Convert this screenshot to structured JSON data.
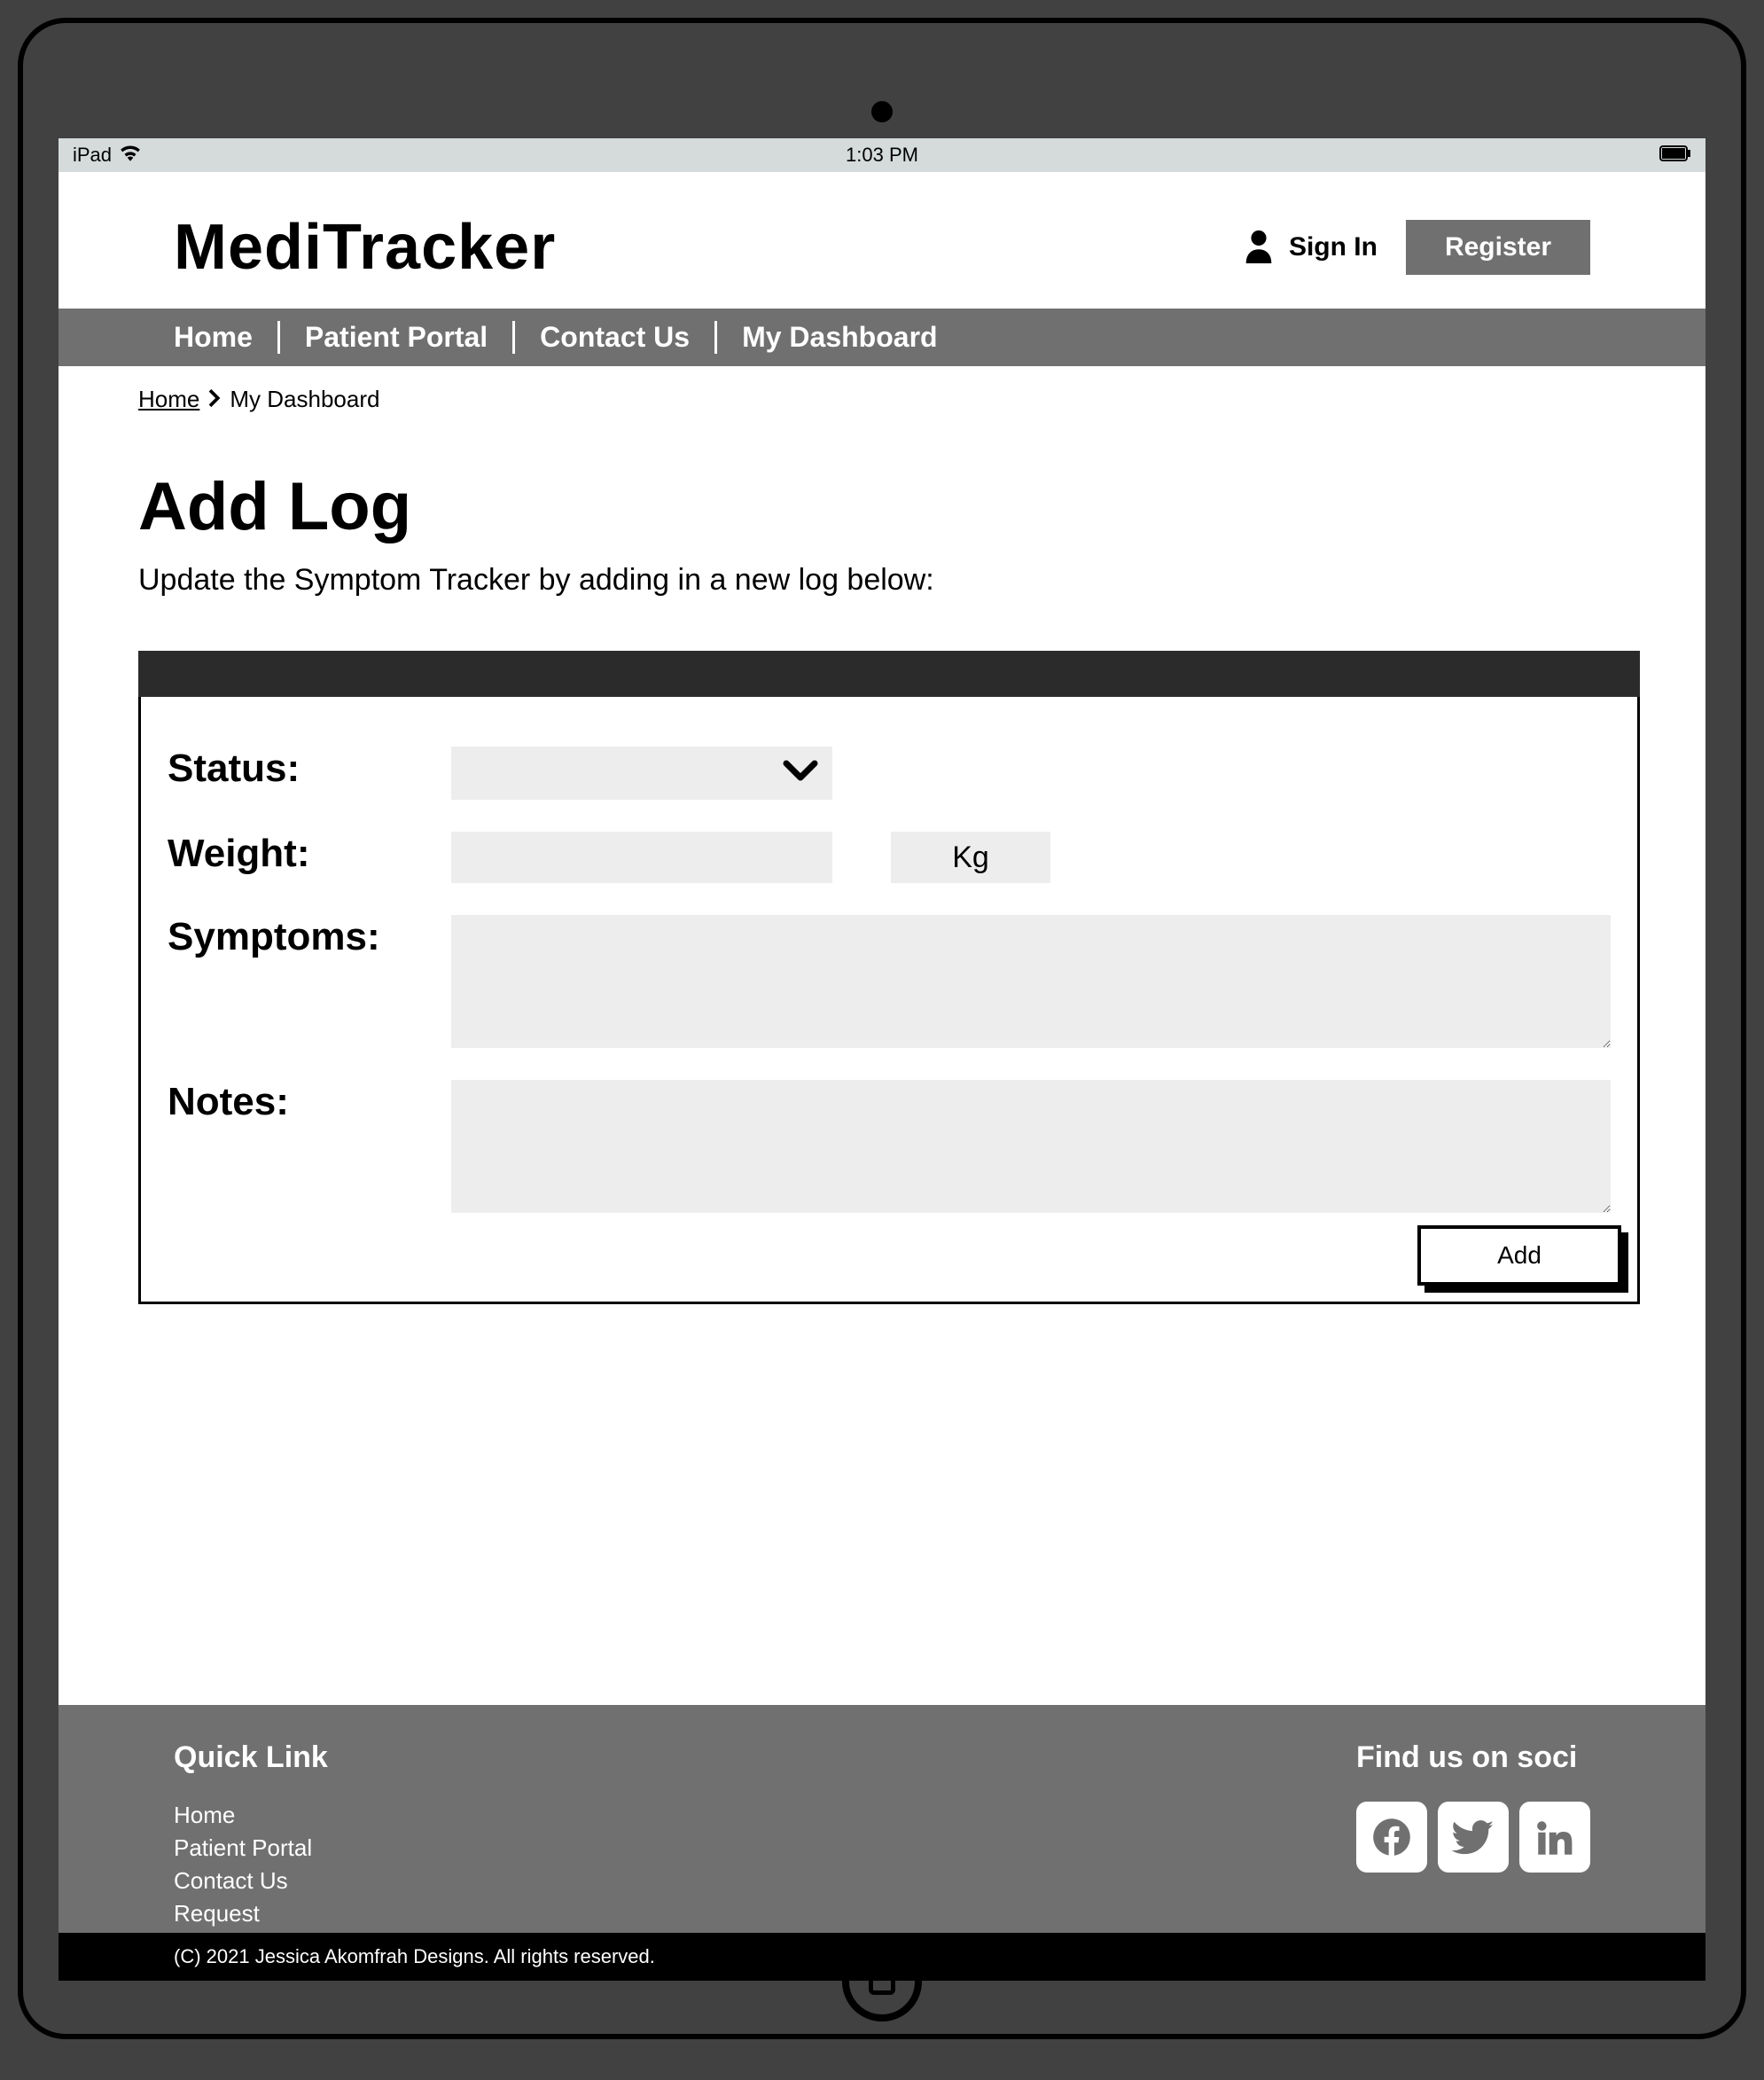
{
  "statusbar": {
    "device": "iPad",
    "time": "1:03 PM"
  },
  "header": {
    "logo": "MediTracker",
    "signin": "Sign In",
    "register": "Register"
  },
  "nav": {
    "items": [
      "Home",
      "Patient Portal",
      "Contact Us",
      "My Dashboard"
    ]
  },
  "breadcrumb": {
    "home": "Home",
    "current": "My Dashboard"
  },
  "page": {
    "title": "Add Log",
    "subtitle": "Update the Symptom Tracker by adding in a new log below:"
  },
  "form": {
    "status_label": "Status:",
    "weight_label": "Weight:",
    "weight_unit": "Kg",
    "symptoms_label": "Symptoms:",
    "notes_label": "Notes:",
    "add_btn": "Add"
  },
  "footer": {
    "quicklinks_title": "Quick Link",
    "quicklinks": [
      "Home",
      "Patient Portal",
      "Contact Us",
      "Request"
    ],
    "social_title": "Find us on soci",
    "copyright": "(C) 2021 Jessica Akomfrah Designs. All rights reserved."
  }
}
